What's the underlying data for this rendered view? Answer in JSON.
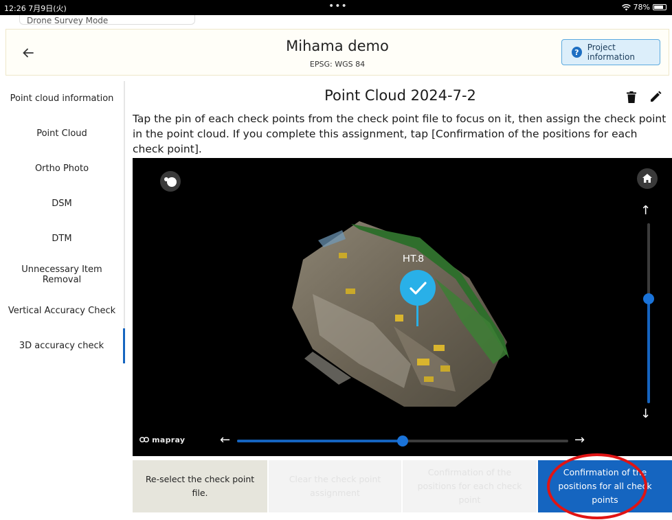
{
  "status_bar": {
    "time": "12:26  7月9日(火)",
    "dots": "•••",
    "battery": "78%"
  },
  "mode": {
    "label": "Drone Survey Mode"
  },
  "header": {
    "back_icon": "arrow-left-icon",
    "title": "Mihama demo",
    "subtitle": "EPSG: WGS 84",
    "project_button": "Project information"
  },
  "sidebar": {
    "items": [
      {
        "label": "Point cloud information"
      },
      {
        "label": "Point Cloud"
      },
      {
        "label": "Ortho Photo"
      },
      {
        "label": "DSM"
      },
      {
        "label": "DTM"
      },
      {
        "label": "Unnecessary Item Removal"
      },
      {
        "label": "Vertical Accuracy Check"
      },
      {
        "label": "3D accuracy check"
      }
    ],
    "active_index": 7
  },
  "content": {
    "title": "Point Cloud 2024-7-2",
    "instructions": "Tap the pin of each check points from the check point file to focus on it, then assign the check point in the point cloud. If you complete this assignment, tap [Confirmation of the positions for each check point]."
  },
  "viewer": {
    "pin_label": "HT.8",
    "logo": "mapray",
    "vertical_slider_level": 0.58,
    "horizontal_slider_level": 0.5,
    "arrows": {
      "up": "↑",
      "down": "↓",
      "left": "←",
      "right": "→"
    }
  },
  "buttons": {
    "reselect": "Re-select the check point file.",
    "clear": "Clear the check point assignment",
    "confirm_each": "Confirmation of the positions for each check point",
    "confirm_all": "Confirmation of the positions for all check points"
  },
  "colors": {
    "accent": "#1565c0",
    "pin": "#29b0e8",
    "highlight_ellipse": "#e01414"
  }
}
